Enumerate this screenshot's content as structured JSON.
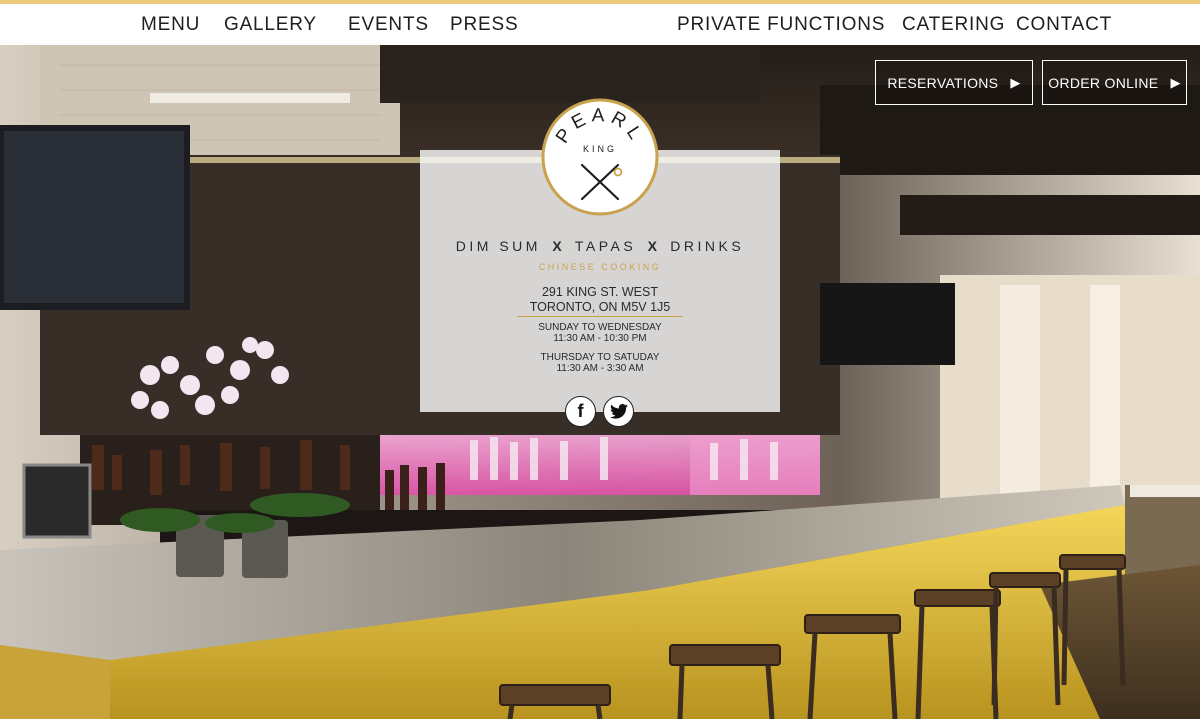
{
  "nav": {
    "menu": "MENU",
    "gallery": "GALLERY",
    "events": "EVENTS",
    "press": "PRESS",
    "private_functions": "PRIVATE FUNCTIONS",
    "catering": "CATERING",
    "contact": "CONTACT"
  },
  "actions": {
    "reservations": "RESERVATIONS",
    "order_online": "ORDER ONLINE"
  },
  "logo": {
    "name": "PEARL",
    "sub": "KING"
  },
  "tagline": {
    "part1": "DIM SUM",
    "sep1": "X",
    "part2": "TAPAS",
    "sep2": "X",
    "part3": "DRINKS",
    "subtitle": "CHINESE COOKING"
  },
  "address": {
    "line1": "291 KING ST. WEST",
    "line2": "TORONTO, ON M5V 1J5"
  },
  "hours": [
    {
      "days": "SUNDAY TO WEDNESDAY",
      "time": "11:30 AM - 10:30 PM"
    },
    {
      "days": "THURSDAY TO SATUDAY",
      "time": "11:30 AM - 3:30 AM"
    }
  ],
  "social": {
    "facebook": "f"
  },
  "colors": {
    "accent": "#e9c97a",
    "gold": "#c9a24e",
    "nav_text": "#1e1e1e"
  }
}
